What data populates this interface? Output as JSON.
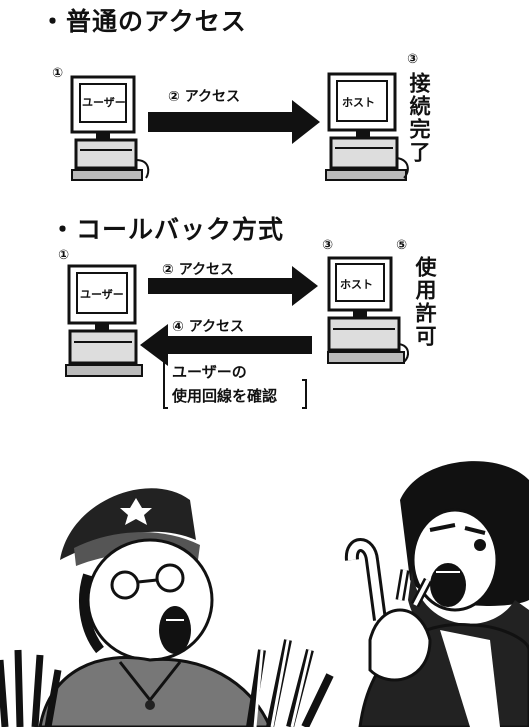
{
  "section1": {
    "title": "・普通のアクセス",
    "user": {
      "num": "①",
      "label": "ユーザー"
    },
    "access": {
      "label": "② アクセス"
    },
    "host": {
      "num": "③",
      "label": "ホスト",
      "status": "接続完了"
    }
  },
  "section2": {
    "title": "・コールバック方式",
    "user": {
      "num": "①",
      "label": "ユーザー"
    },
    "access_out": {
      "label": "② アクセス"
    },
    "host": {
      "num": "③",
      "label": "ホスト"
    },
    "permit": {
      "num": "⑤",
      "status": "使用許可"
    },
    "access_back": {
      "label": "④ アクセス"
    },
    "note": {
      "line1": "ユーザーの",
      "line2": "使用回線を確認"
    }
  },
  "illustration": {
    "icons": [
      "officer-figure-icon",
      "bearded-man-figure-icon"
    ]
  }
}
